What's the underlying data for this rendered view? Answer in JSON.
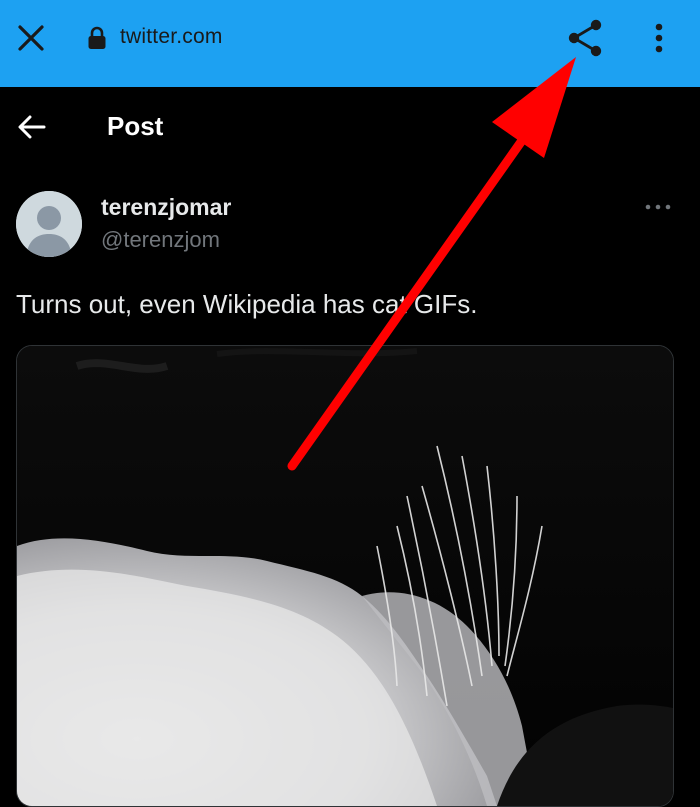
{
  "browser": {
    "url": "twitter.com",
    "bar_color": "#1da1f2",
    "close_icon": "close-icon",
    "lock_icon": "lock-icon",
    "share_icon": "share-icon",
    "menu_icon": "kebab-menu-icon"
  },
  "header": {
    "title": "Post",
    "back_icon": "arrow-left-icon"
  },
  "post": {
    "display_name": "terenzjomar",
    "handle": "@terenzjom",
    "text": "Turns out, even Wikipedia has cat GIFs.",
    "more_icon": "more-horizontal-icon",
    "media": "cat-gif"
  },
  "annotation": {
    "type": "arrow",
    "color": "#ff0000",
    "points_to": "share-button"
  }
}
